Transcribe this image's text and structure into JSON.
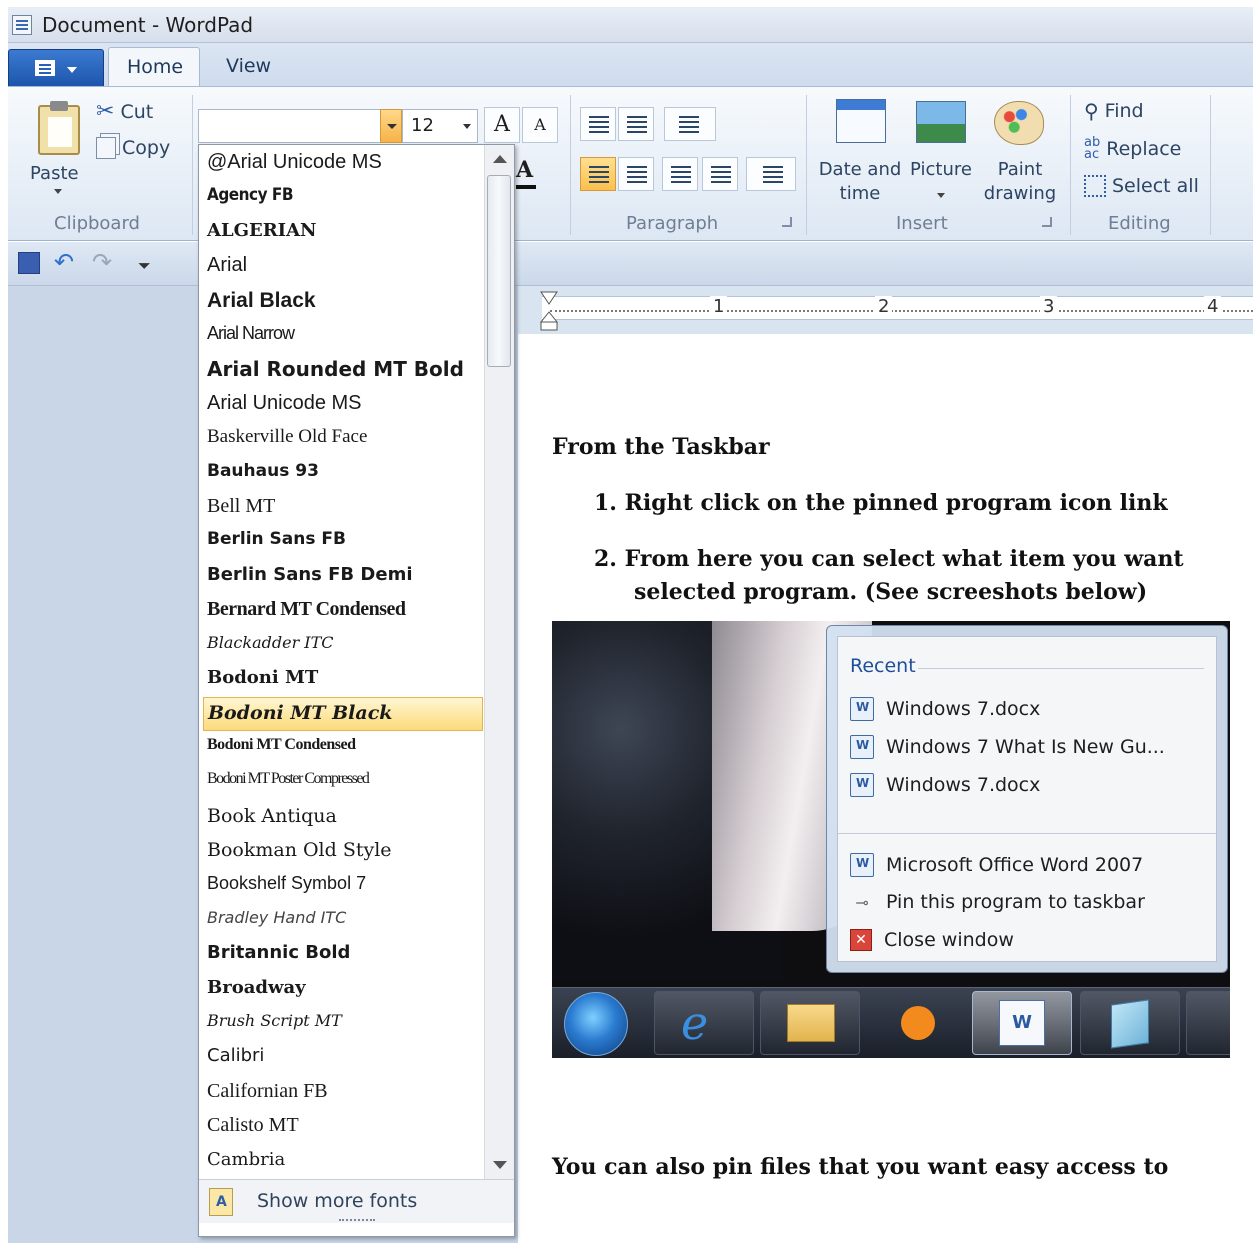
{
  "window": {
    "title": "Document - WordPad"
  },
  "tabs": [
    {
      "label": "Home"
    },
    {
      "label": "View"
    }
  ],
  "clipboard": {
    "paste_label": "Paste",
    "cut_label": "Cut",
    "copy_label": "Copy",
    "group_label": "Clipboard"
  },
  "font": {
    "name_value": "",
    "size_value": "12",
    "grow_label": "A",
    "shrink_label": "A",
    "color_label": "A"
  },
  "paragraph": {
    "group_label": "Paragraph"
  },
  "insert": {
    "datetime_label_1": "Date and",
    "datetime_label_2": "time",
    "picture_label": "Picture",
    "paint_label_1": "Paint",
    "paint_label_2": "drawing",
    "group_label": "Insert"
  },
  "editing": {
    "find_label": "Find",
    "replace_label": "Replace",
    "selectall_label": "Select all",
    "group_label": "Editing"
  },
  "ruler": {
    "marks": [
      "1",
      "2",
      "3",
      "4"
    ]
  },
  "document": {
    "heading": "From the Taskbar",
    "step1": "1.  Right click on the pinned program icon link",
    "step2_line1": "2.  From here you can select what item you want",
    "step2_line2": "selected program. (See screeshots below)",
    "footer_text": "You can also pin files that you want easy access to"
  },
  "jumplist": {
    "recent_header": "Recent",
    "recent_items": [
      "Windows 7.docx",
      "Windows 7 What Is New Gu...",
      "Windows 7.docx"
    ],
    "app_name": "Microsoft Office Word 2007",
    "pin_label": "Pin this program to taskbar",
    "close_label": "Close window"
  },
  "font_dropdown": {
    "fonts": [
      "@Arial Unicode MS",
      "Agency FB",
      "ALGERIAN",
      "Arial",
      "Arial Black",
      "Arial Narrow",
      "Arial Rounded MT Bold",
      "Arial Unicode MS",
      "Baskerville Old Face",
      "Bauhaus 93",
      "Bell MT",
      "Berlin Sans FB",
      "Berlin Sans FB Demi",
      "Bernard MT Condensed",
      "Blackadder ITC",
      "Bodoni MT",
      "Bodoni MT Black",
      "Bodoni MT Condensed",
      "Bodoni MT Poster Compressed",
      "Book Antiqua",
      "Bookman Old Style",
      "Bookshelf Symbol 7",
      "Bradley Hand ITC",
      "Britannic Bold",
      "Broadway",
      "Brush Script MT",
      "Calibri",
      "Californian FB",
      "Calisto MT",
      "Cambria"
    ],
    "selected": "Bodoni MT Black",
    "more_fonts_label": "Show more fonts"
  }
}
